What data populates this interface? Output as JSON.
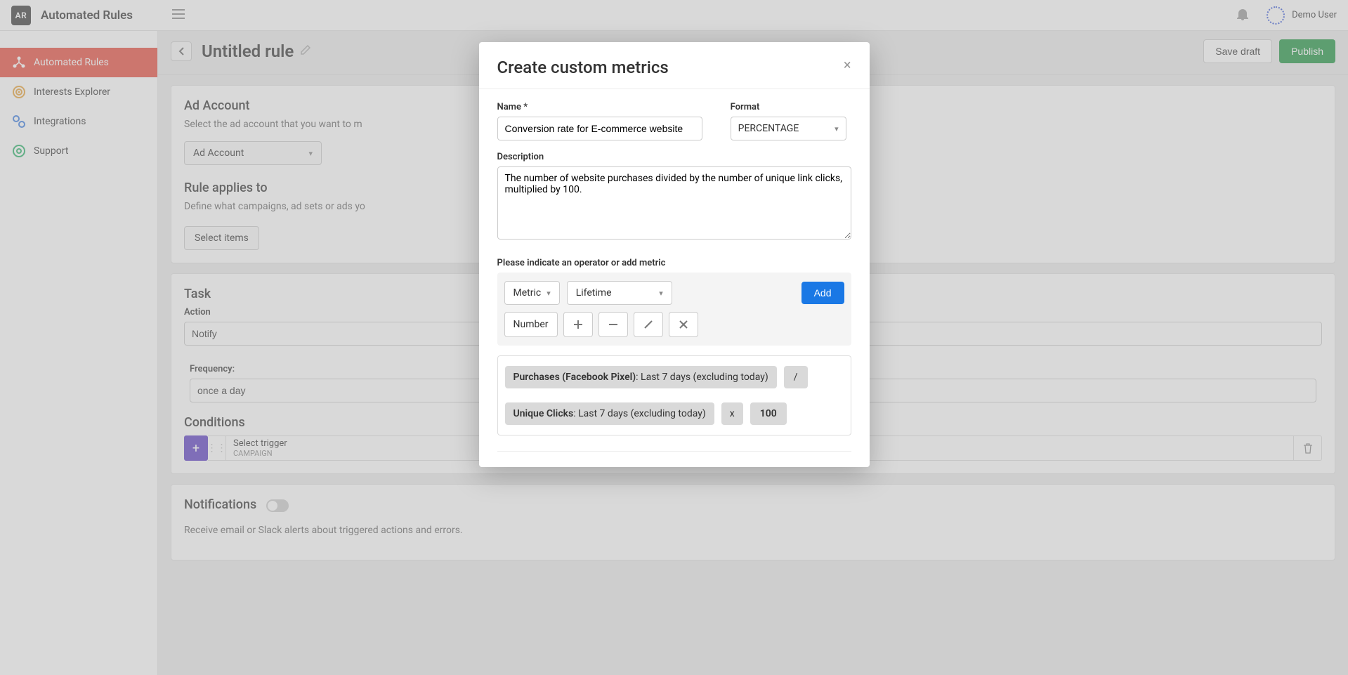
{
  "header": {
    "logo_text": "AR",
    "app_title": "Automated Rules",
    "user_name": "Demo User"
  },
  "sidebar": {
    "items": [
      {
        "label": "Automated Rules"
      },
      {
        "label": "Interests Explorer"
      },
      {
        "label": "Integrations"
      },
      {
        "label": "Support"
      }
    ]
  },
  "page": {
    "title": "Untitled rule",
    "save_draft_label": "Save draft",
    "publish_label": "Publish",
    "ad_account": {
      "title": "Ad Account",
      "desc": "Select the ad account that you want to m",
      "selected": "Ad Account"
    },
    "rule_applies": {
      "title": "Rule applies to",
      "desc": "Define what campaigns, ad sets or ads yo",
      "select_items_label": "Select items"
    },
    "task": {
      "title": "Task",
      "action_label": "Action",
      "action_value": "Notify",
      "frequency_label": "Frequency:",
      "frequency_value": "once a day"
    },
    "conditions": {
      "title": "Conditions",
      "trigger_placeholder": "Select trigger",
      "trigger_scope": "CAMPAIGN",
      "plus": "+"
    },
    "notifications": {
      "title": "Notifications",
      "desc": "Receive email or Slack alerts about triggered actions and errors."
    }
  },
  "modal": {
    "title": "Create custom metrics",
    "name_label": "Name *",
    "name_value": "Conversion rate for E-commerce website",
    "format_label": "Format",
    "format_value": "PERCENTAGE",
    "description_label": "Description",
    "description_value": "The number of website purchases divided by the number of unique link clicks, multiplied by 100.",
    "operator_prompt": "Please indicate an operator or add metric",
    "metric_dd": "Metric",
    "timeframe_dd": "Lifetime",
    "add_button": "Add",
    "number_label": "Number",
    "tokens": {
      "t1_bold": "Purchases (Facebook Pixel)",
      "t1_rest": ": Last 7 days (excluding today)",
      "op1": "/",
      "t2_bold": "Unique Clicks",
      "t2_rest": ": Last 7 days (excluding today)",
      "op2": "x",
      "num": "100"
    }
  }
}
